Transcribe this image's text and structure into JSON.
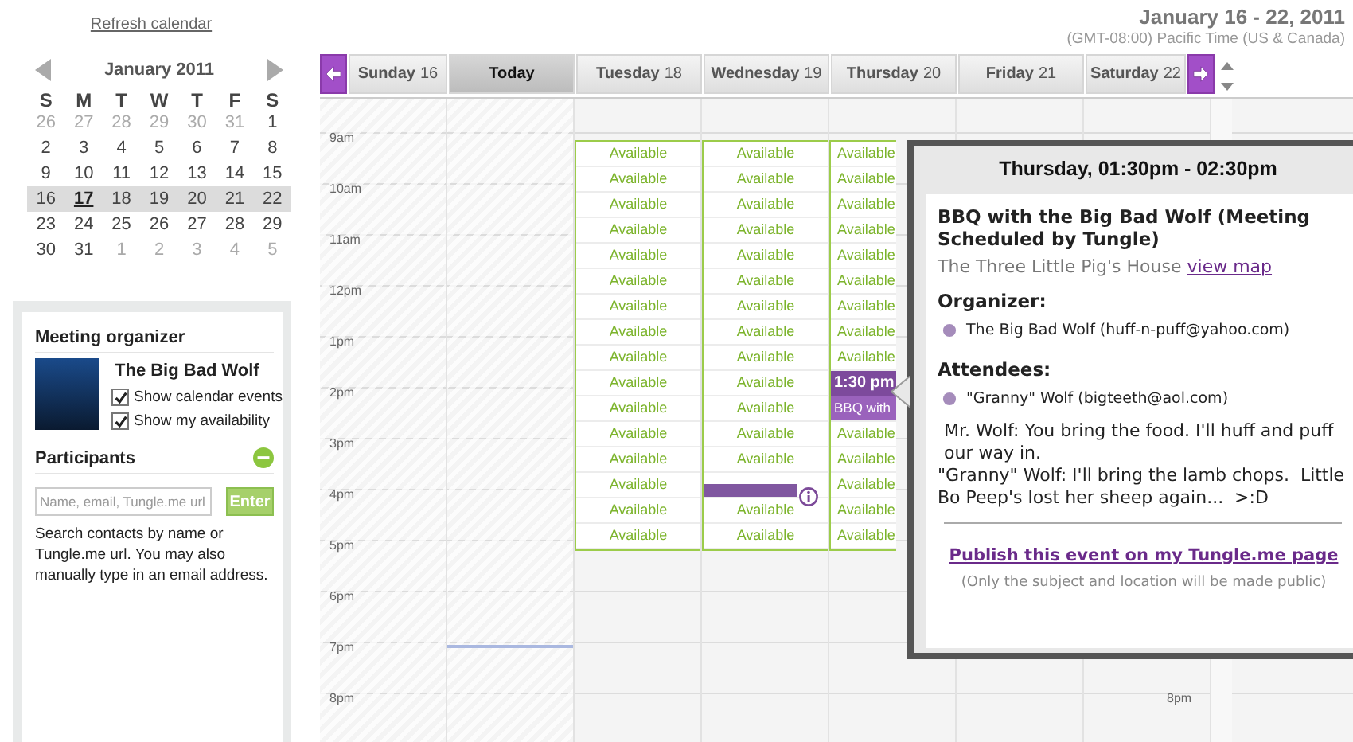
{
  "refresh_link": "Refresh calendar",
  "mini_calendar": {
    "month": "January 2011",
    "weekdays": [
      "S",
      "M",
      "T",
      "W",
      "T",
      "F",
      "S"
    ],
    "weeks": [
      {
        "selected": false,
        "days": [
          {
            "label": "26",
            "other_month": true,
            "today": false
          },
          {
            "label": "27",
            "other_month": true,
            "today": false
          },
          {
            "label": "28",
            "other_month": true,
            "today": false
          },
          {
            "label": "29",
            "other_month": true,
            "today": false
          },
          {
            "label": "30",
            "other_month": true,
            "today": false
          },
          {
            "label": "31",
            "other_month": true,
            "today": false
          },
          {
            "label": "1",
            "other_month": false,
            "today": false
          }
        ]
      },
      {
        "selected": false,
        "days": [
          {
            "label": "2",
            "other_month": false,
            "today": false
          },
          {
            "label": "3",
            "other_month": false,
            "today": false
          },
          {
            "label": "4",
            "other_month": false,
            "today": false
          },
          {
            "label": "5",
            "other_month": false,
            "today": false
          },
          {
            "label": "6",
            "other_month": false,
            "today": false
          },
          {
            "label": "7",
            "other_month": false,
            "today": false
          },
          {
            "label": "8",
            "other_month": false,
            "today": false
          }
        ]
      },
      {
        "selected": false,
        "days": [
          {
            "label": "9",
            "other_month": false,
            "today": false
          },
          {
            "label": "10",
            "other_month": false,
            "today": false
          },
          {
            "label": "11",
            "other_month": false,
            "today": false
          },
          {
            "label": "12",
            "other_month": false,
            "today": false
          },
          {
            "label": "13",
            "other_month": false,
            "today": false
          },
          {
            "label": "14",
            "other_month": false,
            "today": false
          },
          {
            "label": "15",
            "other_month": false,
            "today": false
          }
        ]
      },
      {
        "selected": true,
        "days": [
          {
            "label": "16",
            "other_month": false,
            "today": false
          },
          {
            "label": "17",
            "other_month": false,
            "today": true
          },
          {
            "label": "18",
            "other_month": false,
            "today": false
          },
          {
            "label": "19",
            "other_month": false,
            "today": false
          },
          {
            "label": "20",
            "other_month": false,
            "today": false
          },
          {
            "label": "21",
            "other_month": false,
            "today": false
          },
          {
            "label": "22",
            "other_month": false,
            "today": false
          }
        ]
      },
      {
        "selected": false,
        "days": [
          {
            "label": "23",
            "other_month": false,
            "today": false
          },
          {
            "label": "24",
            "other_month": false,
            "today": false
          },
          {
            "label": "25",
            "other_month": false,
            "today": false
          },
          {
            "label": "26",
            "other_month": false,
            "today": false
          },
          {
            "label": "27",
            "other_month": false,
            "today": false
          },
          {
            "label": "28",
            "other_month": false,
            "today": false
          },
          {
            "label": "29",
            "other_month": false,
            "today": false
          }
        ]
      },
      {
        "selected": false,
        "days": [
          {
            "label": "30",
            "other_month": false,
            "today": false
          },
          {
            "label": "31",
            "other_month": false,
            "today": false
          },
          {
            "label": "1",
            "other_month": true,
            "today": false
          },
          {
            "label": "2",
            "other_month": true,
            "today": false
          },
          {
            "label": "3",
            "other_month": true,
            "today": false
          },
          {
            "label": "4",
            "other_month": true,
            "today": false
          },
          {
            "label": "5",
            "other_month": true,
            "today": false
          }
        ]
      }
    ]
  },
  "organizer_panel": {
    "title": "Meeting organizer",
    "name": "The Big Bad Wolf",
    "options": [
      {
        "label": "Show calendar events",
        "checked": true
      },
      {
        "label": "Show my availability",
        "checked": true
      }
    ],
    "participants_title": "Participants",
    "input": {
      "placeholder": "Name, email, Tungle.me url"
    },
    "enter_button": "Enter",
    "help_text": "Search contacts by name or Tungle.me url. You may also manually type in an email address."
  },
  "week_header": {
    "range": "January 16 - 22, 2011",
    "timezone": "(GMT-08:00) Pacific Time (US & Canada)"
  },
  "day_tabs": [
    {
      "label": "Sunday",
      "date": "16",
      "selected": false
    },
    {
      "label": "Today",
      "selected": true
    },
    {
      "label": "Tuesday",
      "date": "18",
      "selected": false
    },
    {
      "label": "Wednesday",
      "date": "19",
      "selected": false
    },
    {
      "label": "Thursday",
      "date": "20",
      "selected": false
    },
    {
      "label": "Friday",
      "date": "21",
      "selected": false
    },
    {
      "label": "Saturday",
      "date": "22",
      "selected": false
    }
  ],
  "time_labels": [
    "9am",
    "10am",
    "11am",
    "12pm",
    "1pm",
    "2pm",
    "3pm",
    "4pm",
    "5pm",
    "6pm",
    "7pm",
    "8pm"
  ],
  "right_time_labels": [
    "8pm"
  ],
  "columns": [
    {
      "hatched": true,
      "current_time_line": false
    },
    {
      "hatched": true,
      "current_time_line": true
    },
    {
      "hatched": false,
      "current_time_line": false,
      "slots": [
        {
          "kind": "available",
          "text": "Available"
        },
        {
          "kind": "available",
          "text": "Available"
        },
        {
          "kind": "available",
          "text": "Available"
        },
        {
          "kind": "available",
          "text": "Available"
        },
        {
          "kind": "available",
          "text": "Available"
        },
        {
          "kind": "available",
          "text": "Available"
        },
        {
          "kind": "available",
          "text": "Available"
        },
        {
          "kind": "available",
          "text": "Available"
        },
        {
          "kind": "available",
          "text": "Available"
        },
        {
          "kind": "available",
          "text": "Available"
        },
        {
          "kind": "available",
          "text": "Available"
        },
        {
          "kind": "available",
          "text": "Available"
        },
        {
          "kind": "available",
          "text": "Available"
        },
        {
          "kind": "available",
          "text": "Available"
        },
        {
          "kind": "available",
          "text": "Available"
        },
        {
          "kind": "available",
          "text": "Available"
        }
      ]
    },
    {
      "hatched": false,
      "current_time_line": false,
      "slots": [
        {
          "kind": "available",
          "text": "Available"
        },
        {
          "kind": "available",
          "text": "Available"
        },
        {
          "kind": "available",
          "text": "Available"
        },
        {
          "kind": "available",
          "text": "Available"
        },
        {
          "kind": "available",
          "text": "Available"
        },
        {
          "kind": "available",
          "text": "Available"
        },
        {
          "kind": "available",
          "text": "Available"
        },
        {
          "kind": "available",
          "text": "Available"
        },
        {
          "kind": "available",
          "text": "Available"
        },
        {
          "kind": "available",
          "text": "Available"
        },
        {
          "kind": "available",
          "text": "Available"
        },
        {
          "kind": "available",
          "text": "Available"
        },
        {
          "kind": "available",
          "text": "Available"
        },
        {
          "kind": "event-bar"
        },
        {
          "kind": "available",
          "text": "Available"
        },
        {
          "kind": "available",
          "text": "Available"
        }
      ]
    },
    {
      "hatched": false,
      "current_time_line": false,
      "slots": [
        {
          "kind": "available",
          "text": "Available"
        },
        {
          "kind": "available",
          "text": "Available"
        },
        {
          "kind": "available",
          "text": "Available"
        },
        {
          "kind": "available",
          "text": "Available"
        },
        {
          "kind": "available",
          "text": "Available"
        },
        {
          "kind": "available",
          "text": "Available"
        },
        {
          "kind": "available",
          "text": "Available"
        },
        {
          "kind": "available",
          "text": "Available"
        },
        {
          "kind": "available",
          "text": "Available"
        },
        {
          "kind": "event",
          "text": "1:30 pm"
        },
        {
          "kind": "event-body",
          "text": "BBQ with"
        },
        {
          "kind": "available",
          "text": "Available"
        },
        {
          "kind": "available",
          "text": "Available"
        },
        {
          "kind": "available",
          "text": "Available"
        },
        {
          "kind": "available",
          "text": "Available"
        },
        {
          "kind": "available",
          "text": "Available"
        }
      ]
    },
    {
      "hatched": false,
      "current_time_line": false
    },
    {
      "hatched": false,
      "current_time_line": false
    }
  ],
  "popup": {
    "heading": "Thursday, 01:30pm - 02:30pm",
    "title": "BBQ with the Big Bad Wolf (Meeting Scheduled by Tungle)",
    "location": "The Three Little Pig's House",
    "map_link": "view map",
    "organizer_label": "Organizer:",
    "organizer": "The Big Bad Wolf (huff-n-puff@yahoo.com)",
    "attendees_label": "Attendees:",
    "attendees": [
      "\"Granny\" Wolf (bigteeth@aol.com)"
    ],
    "notes": [
      "Mr. Wolf: You bring the food. I'll huff and puff our way in.",
      "\"Granny\" Wolf: I'll bring the lamb chops.  Little Bo Peep's lost her sheep again...  >:D"
    ],
    "publish_link": "Publish this event on my Tungle.me page",
    "publish_note": "(Only the subject and location will be made public)"
  }
}
